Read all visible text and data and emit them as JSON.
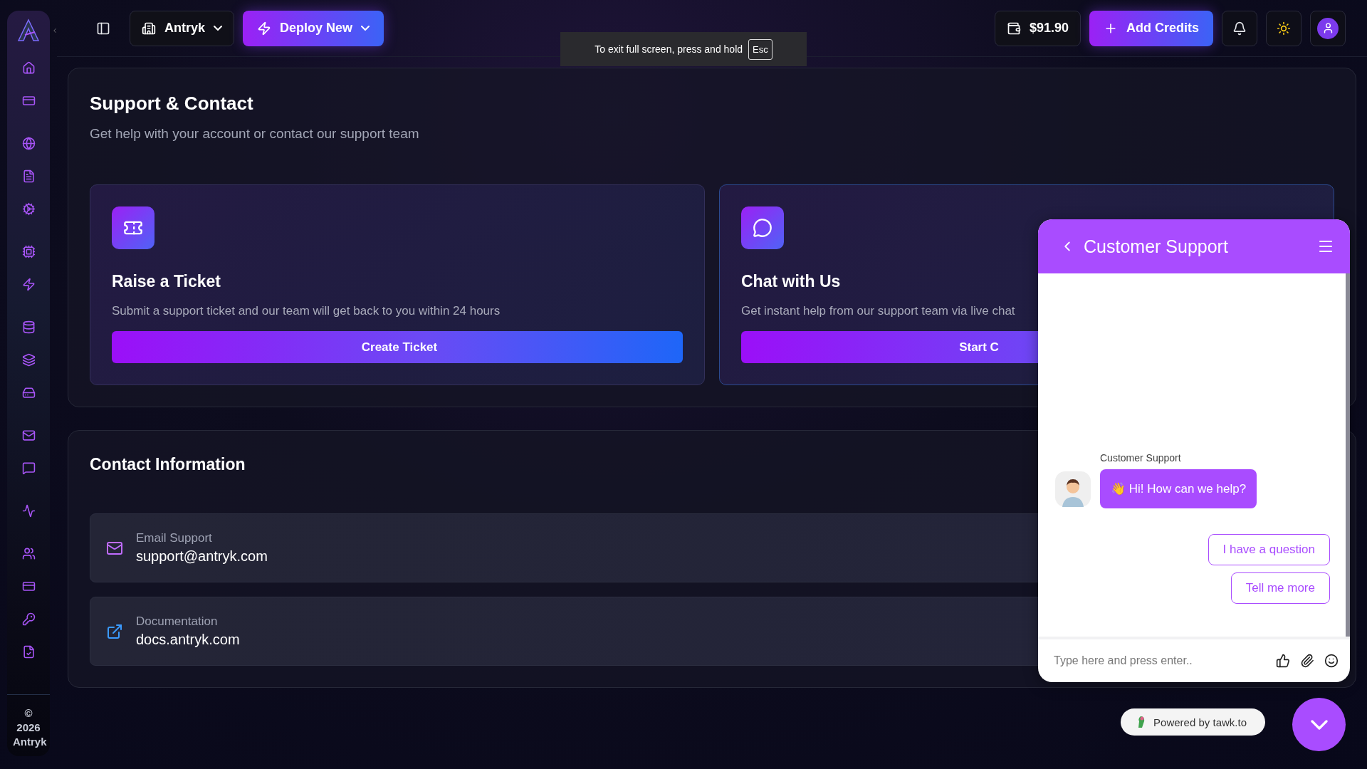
{
  "sidebar": {
    "footer": "© 2026 Antryk"
  },
  "topbar": {
    "workspace": "Antryk",
    "deploy_button": "Deploy New",
    "balance": "$91.90",
    "add_credits_button": "Add Credits"
  },
  "fullscreen_notice": {
    "text": "To exit full screen, press and hold",
    "key": "Esc"
  },
  "page": {
    "title": "Support & Contact",
    "subtitle": "Get help with your account or contact our support team"
  },
  "options": [
    {
      "kind": "ticket",
      "title": "Raise a Ticket",
      "description": "Submit a support ticket and our team will get back to you within 24 hours",
      "button": "Create Ticket"
    },
    {
      "kind": "chat",
      "title": "Chat with Us",
      "description": "Get instant help from our support team via live chat",
      "button": "Start C"
    }
  ],
  "contact": {
    "title": "Contact Information",
    "items": [
      {
        "kind": "email",
        "label": "Email Support",
        "value": "support@antryk.com"
      },
      {
        "kind": "link",
        "label": "Documentation",
        "value": "docs.antryk.com"
      }
    ]
  },
  "chat": {
    "title": "Customer Support",
    "agent_name": "Customer Support",
    "message": "👋 Hi! How can we help?",
    "quick_replies": [
      "I have a question",
      "Tell me more"
    ],
    "placeholder": "Type here and press enter..",
    "powered_by": "Powered by tawk.to"
  }
}
